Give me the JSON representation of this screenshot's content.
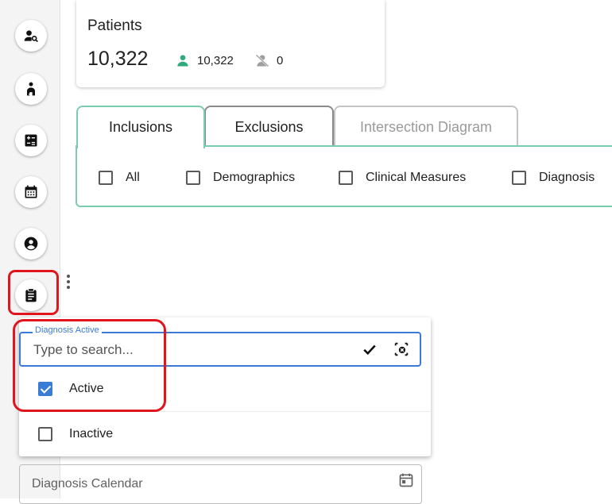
{
  "colors": {
    "accent": "#3a7bd5",
    "teal_border": "#7ccdad",
    "patient_green": "#2faa7a",
    "highlight_red": "#e0161e"
  },
  "sidebar": {
    "items": [
      {
        "icon": "user-search-icon"
      },
      {
        "icon": "patient-user-icon"
      },
      {
        "icon": "calculator-icon"
      },
      {
        "icon": "calendar-icon"
      },
      {
        "icon": "account-circle-icon"
      },
      {
        "icon": "clipboard-icon"
      }
    ]
  },
  "patients": {
    "title": "Patients",
    "total": "10,322",
    "active_count": "10,322",
    "inactive_count": "0"
  },
  "tabs": [
    {
      "label": "Inclusions",
      "state": "active"
    },
    {
      "label": "Exclusions",
      "state": "normal"
    },
    {
      "label": "Intersection Diagram",
      "state": "disabled"
    }
  ],
  "filters": [
    {
      "label": "All",
      "checked": false
    },
    {
      "label": "Demographics",
      "checked": false
    },
    {
      "label": "Clinical Measures",
      "checked": false
    },
    {
      "label": "Diagnosis",
      "checked": false
    }
  ],
  "diagnosis_active": {
    "label": "Diagnosis Active",
    "placeholder": "Type to search...",
    "options": [
      {
        "label": "Active",
        "checked": true
      },
      {
        "label": "Inactive",
        "checked": false
      }
    ]
  },
  "diagnosis_calendar": {
    "placeholder": "Diagnosis Calendar"
  }
}
